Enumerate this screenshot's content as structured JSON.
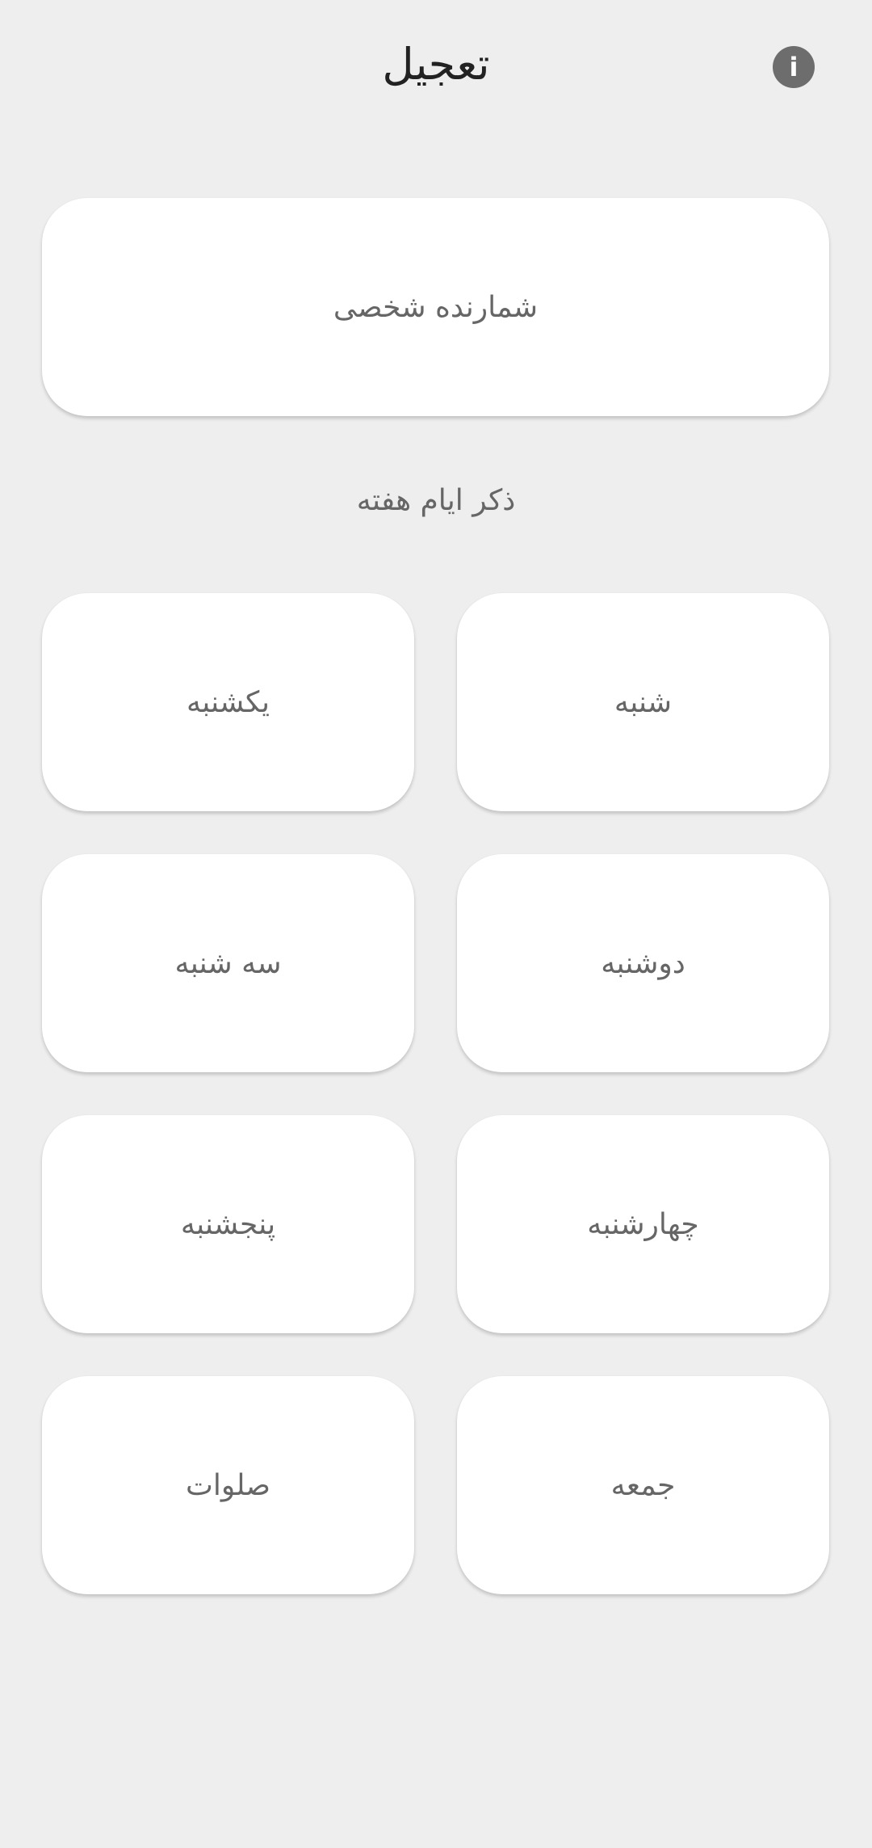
{
  "header": {
    "title": "تعجیل",
    "info_icon_glyph": "i"
  },
  "counter": {
    "label": "شمارنده شخصی"
  },
  "section": {
    "title": "ذکر ایام هفته"
  },
  "days": [
    {
      "label": "شنبه"
    },
    {
      "label": "یکشنبه"
    },
    {
      "label": "دوشنبه"
    },
    {
      "label": "سه شنبه"
    },
    {
      "label": "چهارشنبه"
    },
    {
      "label": "پنجشنبه"
    },
    {
      "label": "جمعه"
    },
    {
      "label": "صلوات"
    }
  ],
  "colors": {
    "background": "#eeeeee",
    "card": "#ffffff",
    "info_button": "#6d6d6d",
    "title_text": "#222222",
    "label_text": "#666666"
  }
}
